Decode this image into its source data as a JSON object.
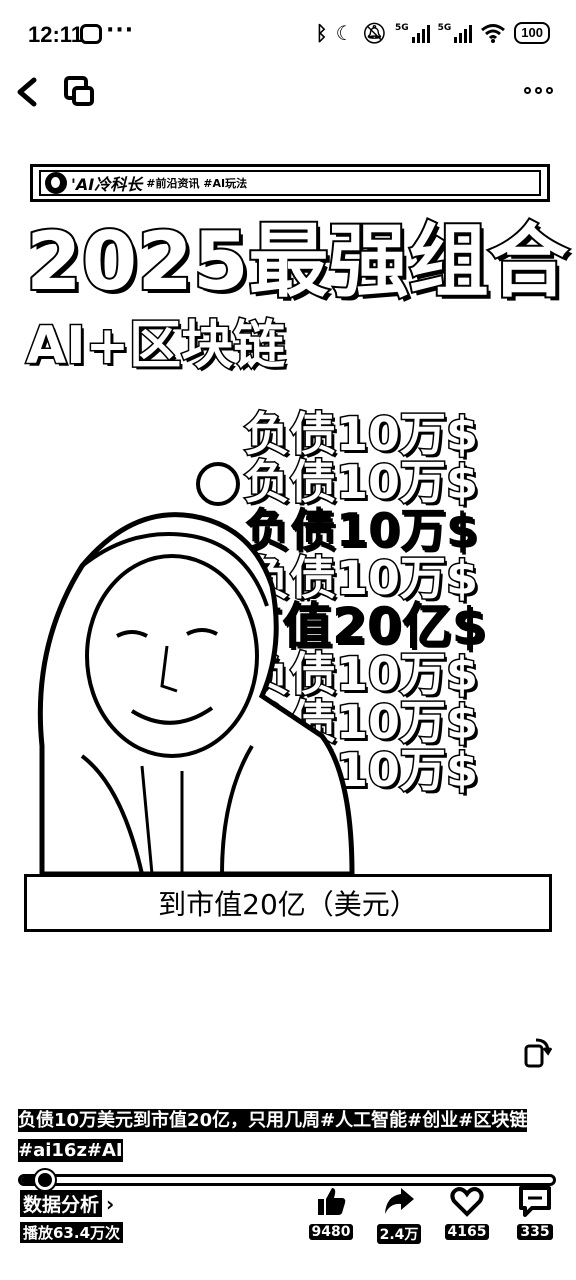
{
  "status_bar": {
    "time": "12:11",
    "dots": "···",
    "battery": "100",
    "signal_label_1": "5G",
    "signal_label_2": "5G"
  },
  "post": {
    "tag_brand": "'AI冷科长",
    "tag_topics": "#前沿资讯 #AI玩法",
    "headline": "2025最强组合",
    "subhead": "AI+区块链",
    "debt_line": "负债10万$",
    "market_cap_line": "市值20亿$",
    "caption": "到市值20亿（美元）"
  },
  "description": {
    "text": "负债10万美元到市值20亿，只用几周#人工智能#创业#区块链#ai16z#AI"
  },
  "playback": {
    "progress": 0.05
  },
  "stats": {
    "data_analysis": "数据分析",
    "plays": "播放63.4万次",
    "likes": "9480",
    "shares": "2.4万",
    "favorites": "4165",
    "comments": "335"
  }
}
